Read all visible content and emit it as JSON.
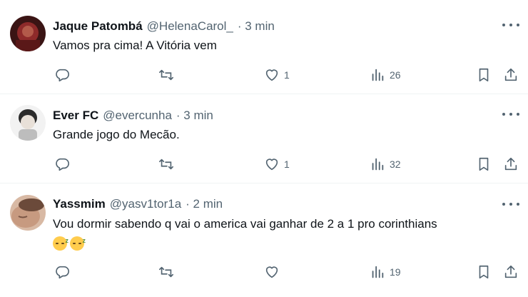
{
  "tweets": [
    {
      "name": "Jaque Patombá",
      "handle": "@HelenaCarol_",
      "time": "· 3 min",
      "text": "Vamos pra cima! A Vitória vem",
      "likes": "1",
      "views": "26",
      "avatar_color": "#7a2b2b"
    },
    {
      "name": "Ever FC",
      "handle": "@evercunha",
      "time": "· 3 min",
      "text": "Grande jogo do Mecão.",
      "likes": "1",
      "views": "32",
      "avatar_color": "#d9d9d9"
    },
    {
      "name": "Yassmim",
      "handle": "@yasv1tor1a",
      "time": "· 2 min",
      "text": "Vou dormir sabendo q vai o america vai ganhar de 2 a 1 pro corinthians",
      "emojis": [
        "sleeping-face",
        "sleeping-face"
      ],
      "likes": "",
      "views": "19",
      "avatar_color": "#c8a088"
    }
  ],
  "colors": {
    "text": "#0f1419",
    "secondary": "#536471",
    "divider": "#eff3f4"
  }
}
